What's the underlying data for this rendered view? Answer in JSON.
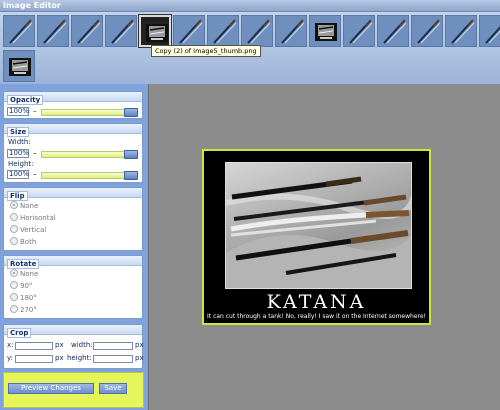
{
  "window": {
    "title": "Image Editor"
  },
  "thumbnails": {
    "tooltip": "Copy (2) of Image5_thumb.png",
    "items": [
      {
        "icon": "katana-thumb-icon"
      },
      {
        "icon": "katana-thumb-icon"
      },
      {
        "icon": "katana-thumb-icon"
      },
      {
        "icon": "katana-thumb-icon"
      },
      {
        "icon": "poster-thumb-icon"
      },
      {
        "icon": "katana-thumb-icon"
      },
      {
        "icon": "katana-thumb-icon"
      },
      {
        "icon": "katana-thumb-icon"
      },
      {
        "icon": "katana-thumb-icon"
      },
      {
        "icon": "poster-thumb-icon"
      },
      {
        "icon": "katana-thumb-icon"
      },
      {
        "icon": "katana-thumb-icon"
      },
      {
        "icon": "katana-thumb-icon"
      },
      {
        "icon": "katana-thumb-icon"
      },
      {
        "icon": "katana-thumb-icon"
      },
      {
        "icon": "poster-thumb-icon"
      }
    ],
    "selected_index": 4
  },
  "opacity": {
    "label": "Opacity",
    "value": "100%",
    "dash": "–",
    "level": 1.0
  },
  "size": {
    "label": "Size",
    "width_label": "Width:",
    "width_value": "100%",
    "width_level": 1.0,
    "height_label": "Height:",
    "height_value": "100%",
    "height_level": 1.0,
    "dash": "–"
  },
  "flip": {
    "label": "Flip",
    "options": [
      "None",
      "Horisontal",
      "Vertical",
      "Both"
    ],
    "selected": "None"
  },
  "rotate": {
    "label": "Rotate",
    "options": [
      "None",
      "90°",
      "180°",
      "270°"
    ],
    "selected": "None"
  },
  "crop": {
    "label": "Crop",
    "x_label": "x:",
    "y_label": "y:",
    "width_label": "width:",
    "height_label": "height:",
    "unit": "px",
    "x_value": "",
    "y_value": "",
    "width_value": "",
    "height_value": ""
  },
  "actions": {
    "preview_label": "Preview Changes",
    "save_label": "Save"
  },
  "poster": {
    "title": "KATANA",
    "subtitle": "It can cut through a tank!  No, really!  I saw it on the Internet somewhere!"
  },
  "colors": {
    "accent": "#c8e63c",
    "sidebar": "#7fa2dc",
    "canvas": "#8c8c8c"
  }
}
